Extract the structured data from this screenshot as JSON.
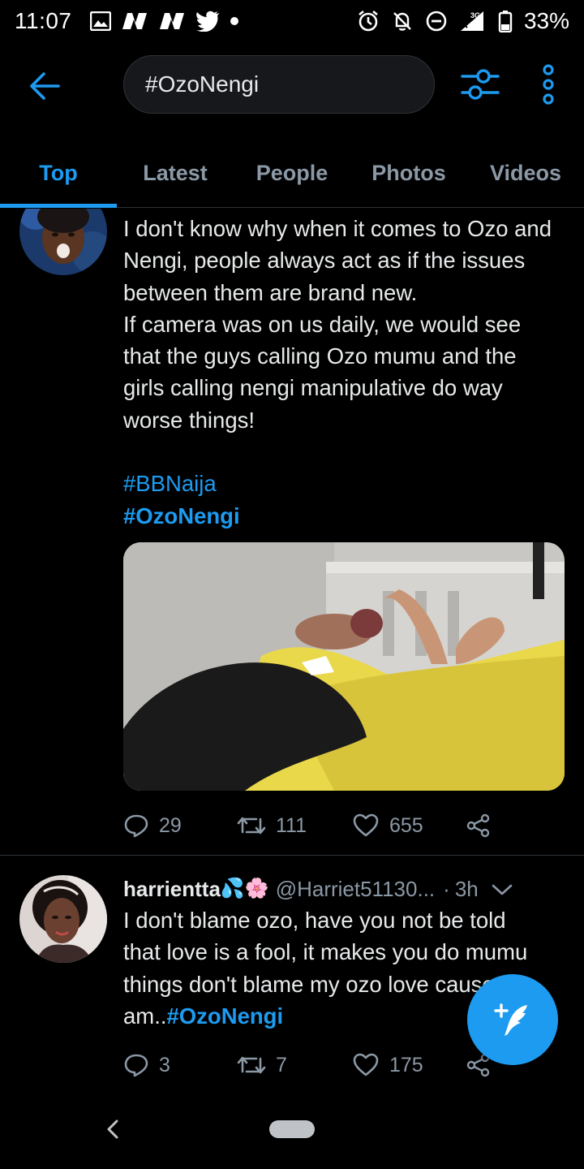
{
  "status_bar": {
    "time": "11:07",
    "battery": "33%",
    "network": "3G",
    "icons": [
      "image-icon",
      "n-app-icon",
      "n-app-icon",
      "twitter-bird-icon",
      "dot-icon",
      "alarm-icon",
      "bell-off-icon",
      "do-not-disturb-icon",
      "signal-icon",
      "battery-icon"
    ]
  },
  "search": {
    "query": "#OzoNengi"
  },
  "tabs": [
    {
      "label": "Top"
    },
    {
      "label": "Latest"
    },
    {
      "label": "People"
    },
    {
      "label": "Photos"
    },
    {
      "label": "Videos"
    }
  ],
  "tweet1": {
    "text": "I don't know why when it comes to Ozo and Nengi, people always act as if the issues between them are brand new.\nIf camera was on us daily, we would see that the guys calling Ozo mumu and the girls calling nengi manipulative do way worse things!\n\n",
    "hashtag1": "#BBNaija",
    "hashtag2": "#OzoNengi",
    "replies": "29",
    "retweets": "111",
    "likes": "655"
  },
  "tweet2": {
    "display_name": "harrientta",
    "name_emojis": "💦🌸",
    "handle": "@Harriet51130...",
    "separator": "·",
    "time": "3h",
    "text": "I don't blame ozo, have you not be told that love is a fool, it makes you do mumu things don't blame my ozo love cause am..",
    "hashtag": "#OzoNengi",
    "replies": "3",
    "retweets": "7",
    "likes": "175"
  },
  "colors": {
    "accent": "#1d9bf0",
    "background": "#000000",
    "muted": "#8b98a5"
  }
}
